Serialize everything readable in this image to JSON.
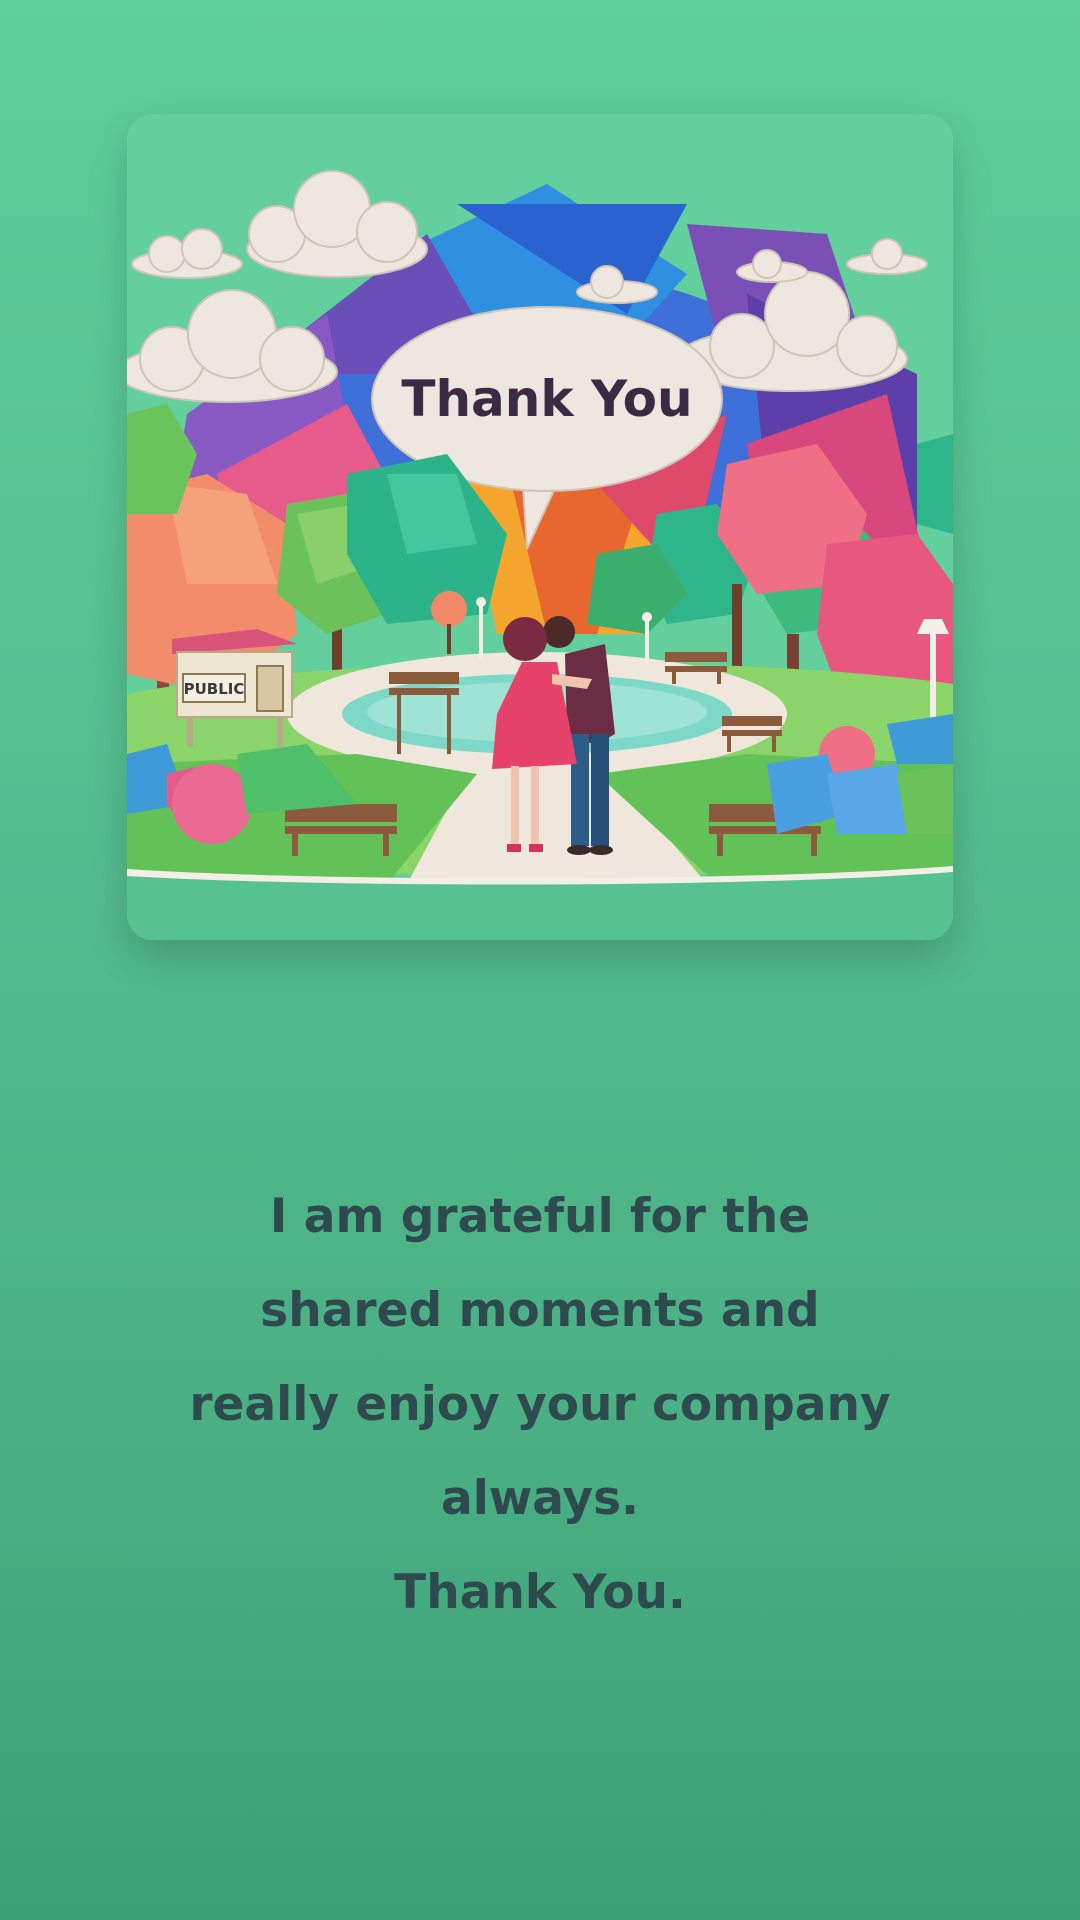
{
  "card": {
    "bubble_text": "Thank You",
    "sign_text": "PUBLIC"
  },
  "message": {
    "lines": [
      "I am grateful for the",
      "shared moments and",
      "really enjoy your company",
      "always.",
      "Thank You."
    ]
  },
  "colors": {
    "background_top": "#5fcf9b",
    "background_bottom": "#3d9f77",
    "text": "#2f4a4f",
    "bubble_text": "#3b2a44"
  }
}
